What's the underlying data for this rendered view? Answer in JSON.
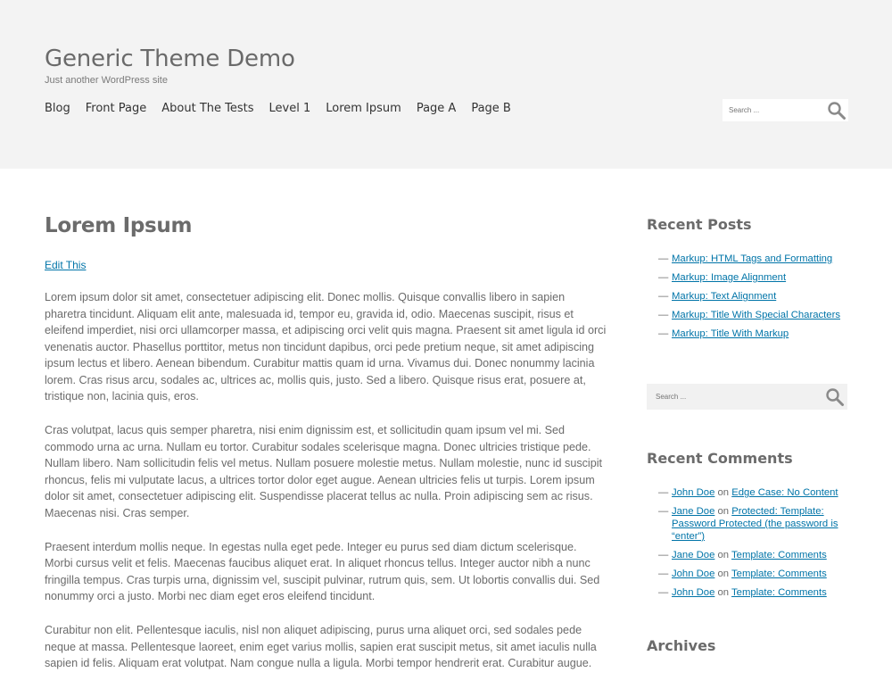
{
  "header": {
    "site_title": "Generic Theme Demo",
    "site_description": "Just another WordPress site",
    "nav": [
      "Blog",
      "Front Page",
      "About The Tests",
      "Level 1",
      "Lorem Ipsum",
      "Page A",
      "Page B"
    ],
    "search_placeholder": "Search ..."
  },
  "main": {
    "title": "Lorem Ipsum",
    "edit_link": "Edit This",
    "paragraphs": [
      "Lorem ipsum dolor sit amet, consectetuer adipiscing elit. Donec mollis. Quisque convallis libero in sapien pharetra tincidunt. Aliquam elit ante, malesuada id, tempor eu, gravida id, odio. Maecenas suscipit, risus et eleifend imperdiet, nisi orci ullamcorper massa, et adipiscing orci velit quis magna. Praesent sit amet ligula id orci venenatis auctor. Phasellus porttitor, metus non tincidunt dapibus, orci pede pretium neque, sit amet adipiscing ipsum lectus et libero. Aenean bibendum. Curabitur mattis quam id urna. Vivamus dui. Donec nonummy lacinia lorem. Cras risus arcu, sodales ac, ultrices ac, mollis quis, justo. Sed a libero. Quisque risus erat, posuere at, tristique non, lacinia quis, eros.",
      "Cras volutpat, lacus quis semper pharetra, nisi enim dignissim est, et sollicitudin quam ipsum vel mi. Sed commodo urna ac urna. Nullam eu tortor. Curabitur sodales scelerisque magna. Donec ultricies tristique pede. Nullam libero. Nam sollicitudin felis vel metus. Nullam posuere molestie metus. Nullam molestie, nunc id suscipit rhoncus, felis mi vulputate lacus, a ultrices tortor dolor eget augue. Aenean ultricies felis ut turpis. Lorem ipsum dolor sit amet, consectetuer adipiscing elit. Suspendisse placerat tellus ac nulla. Proin adipiscing sem ac risus. Maecenas nisi. Cras semper.",
      "Praesent interdum mollis neque. In egestas nulla eget pede. Integer eu purus sed diam dictum scelerisque. Morbi cursus velit et felis. Maecenas faucibus aliquet erat. In aliquet rhoncus tellus. Integer auctor nibh a nunc fringilla tempus. Cras turpis urna, dignissim vel, suscipit pulvinar, rutrum quis, sem. Ut lobortis convallis dui. Sed nonummy orci a justo. Morbi nec diam eget eros eleifend tincidunt.",
      "Curabitur non elit. Pellentesque iaculis, nisl non aliquet adipiscing, purus urna aliquet orci, sed sodales pede neque at massa. Pellentesque laoreet, enim eget varius mollis, sapien erat suscipit metus, sit amet iaculis nulla sapien id felis. Aliquam erat volutpat. Nam congue nulla a ligula. Morbi tempor hendrerit erat. Curabitur augue."
    ]
  },
  "sidebar": {
    "recent_posts_title": "Recent Posts",
    "recent_posts": [
      "Markup: HTML Tags and Formatting",
      "Markup: Image Alignment",
      "Markup: Text Alignment",
      "Markup: Title With Special Characters",
      "Markup: Title With Markup"
    ],
    "search_placeholder": "Search ...",
    "recent_comments_title": "Recent Comments",
    "recent_comments": [
      {
        "author": "John Doe",
        "on": "on",
        "post": "Edge Case: No Content"
      },
      {
        "author": "Jane Doe",
        "on": "on",
        "post": "Protected: Template: Password Protected (the password is “enter”)"
      },
      {
        "author": "Jane Doe",
        "on": "on",
        "post": "Template: Comments"
      },
      {
        "author": "John Doe",
        "on": "on",
        "post": "Template: Comments"
      },
      {
        "author": "John Doe",
        "on": "on",
        "post": "Template: Comments"
      }
    ],
    "archives_title": "Archives",
    "dash": "—"
  }
}
